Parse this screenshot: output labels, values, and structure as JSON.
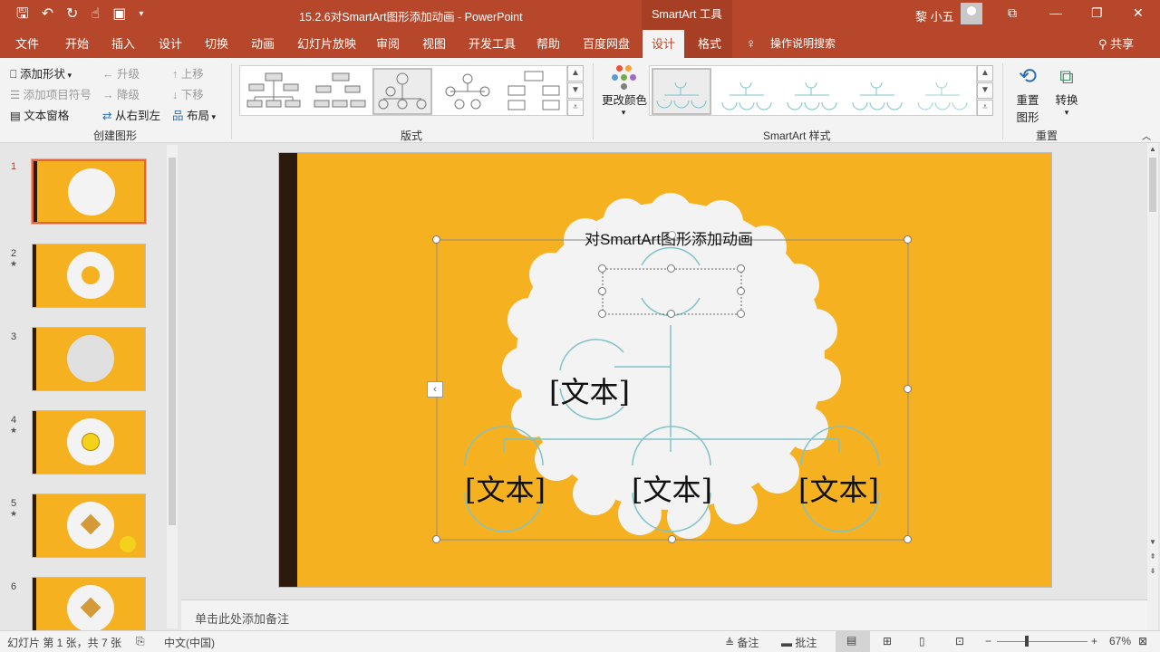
{
  "window": {
    "title": "15.2.6对SmartArt图形添加动画 - PowerPoint",
    "context_tools": "SmartArt 工具",
    "user": "黎 小五"
  },
  "tabs": [
    "文件",
    "开始",
    "插入",
    "设计",
    "切换",
    "动画",
    "幻灯片放映",
    "审阅",
    "视图",
    "开发工具",
    "帮助",
    "百度网盘",
    "设计",
    "格式"
  ],
  "tell_me": "操作说明搜索",
  "share": "共享",
  "ribbon": {
    "create": {
      "add_shape": "添加形状",
      "add_bullet": "添加项目符号",
      "text_pane": "文本窗格",
      "promote": "升级",
      "demote": "降级",
      "rtl": "从右到左",
      "move_up": "上移",
      "move_down": "下移",
      "layout": "布局",
      "label": "创建图形"
    },
    "layouts_label": "版式",
    "change_colors": "更改颜色",
    "styles_label": "SmartArt 样式",
    "reset_graphic": "重置\n图形",
    "reset_graphic_l1": "重置",
    "reset_graphic_l2": "图形",
    "convert": "转换",
    "reset_label": "重置"
  },
  "slides": {
    "numbers": [
      "1",
      "2",
      "3",
      "4",
      "5",
      "6"
    ]
  },
  "slide": {
    "title": "对SmartArt图形添加动画",
    "nodes": [
      "[文本]",
      "[文本]",
      "[文本]",
      "[文本]"
    ]
  },
  "notes_placeholder": "单击此处添加备注",
  "status": {
    "slide_info": "幻灯片 第 1 张，共 7 张",
    "language": "中文(中国)",
    "notes": "备注",
    "comments": "批注",
    "zoom": "67%"
  },
  "colors": {
    "accent": "#b7472a",
    "slide_bg": "#f5b120",
    "cloud": "#f3f3f3",
    "connector": "#7fc3c8"
  }
}
